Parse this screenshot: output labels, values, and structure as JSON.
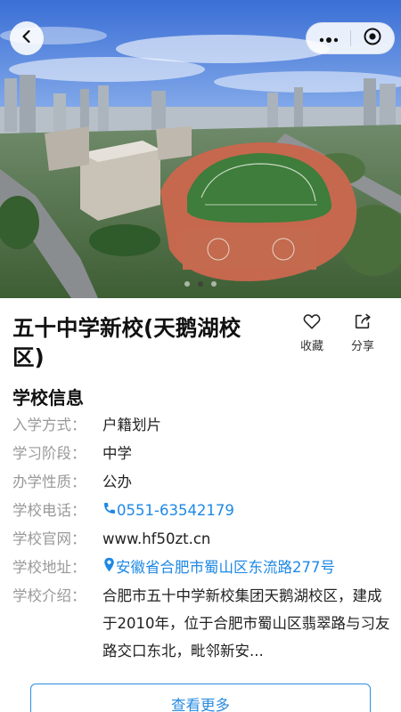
{
  "nav": {
    "back_icon": "chevron-left-icon",
    "more_icon": "more-dots-icon",
    "close_icon": "target-circle-icon"
  },
  "carousel": {
    "total": 3,
    "active": 1
  },
  "school": {
    "name": "五十中学新校(天鹅湖校区)",
    "favorite_label": "收藏",
    "share_label": "分享"
  },
  "info": {
    "section_title": "学校信息",
    "rows": [
      {
        "key": "入学方式：",
        "value": "户籍划片"
      },
      {
        "key": "学习阶段：",
        "value": "中学"
      },
      {
        "key": "办学性质：",
        "value": "公办"
      },
      {
        "key": "学校电话：",
        "value": "0551-63542179"
      },
      {
        "key": "学校官网：",
        "value": "www.hf50zt.cn"
      },
      {
        "key": "学校地址：",
        "value": "安徽省合肥市蜀山区东流路277号"
      },
      {
        "key": "学校介绍：",
        "value": "合肥市五十中学新校集团天鹅湖校区，建成于2010年，位于合肥市蜀山区翡翠路与习友路交口东北，毗邻新安..."
      }
    ]
  },
  "more_button": "查看更多",
  "colors": {
    "accent": "#1e88e5",
    "label_gray": "#999999"
  }
}
